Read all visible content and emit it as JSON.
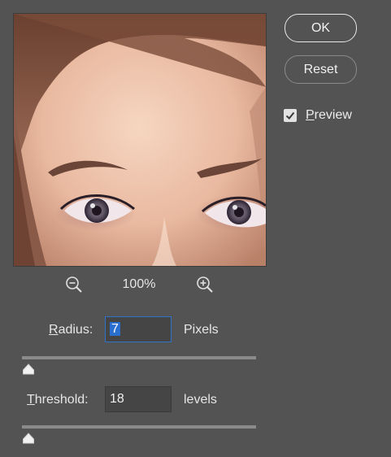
{
  "preview": {
    "image_description": "close-up of face with eyes"
  },
  "zoom": {
    "level": "100%",
    "zoom_out_icon": "zoom-out-icon",
    "zoom_in_icon": "zoom-in-icon"
  },
  "buttons": {
    "ok_label": "OK",
    "reset_label": "Reset"
  },
  "preview_toggle": {
    "label_mnemonic": "P",
    "label_rest": "review",
    "checked": true
  },
  "radius": {
    "label_mnemonic": "R",
    "label_rest": "adius:",
    "value": "7",
    "unit": "Pixels",
    "slider_fraction": 0.0
  },
  "threshold": {
    "label_mnemonic": "T",
    "label_rest": "hreshold:",
    "value": "18",
    "unit": "levels",
    "slider_fraction": 0.0
  },
  "colors": {
    "background": "#535353",
    "accent_focus": "#2f73c9",
    "selection": "#2a6fd0"
  }
}
